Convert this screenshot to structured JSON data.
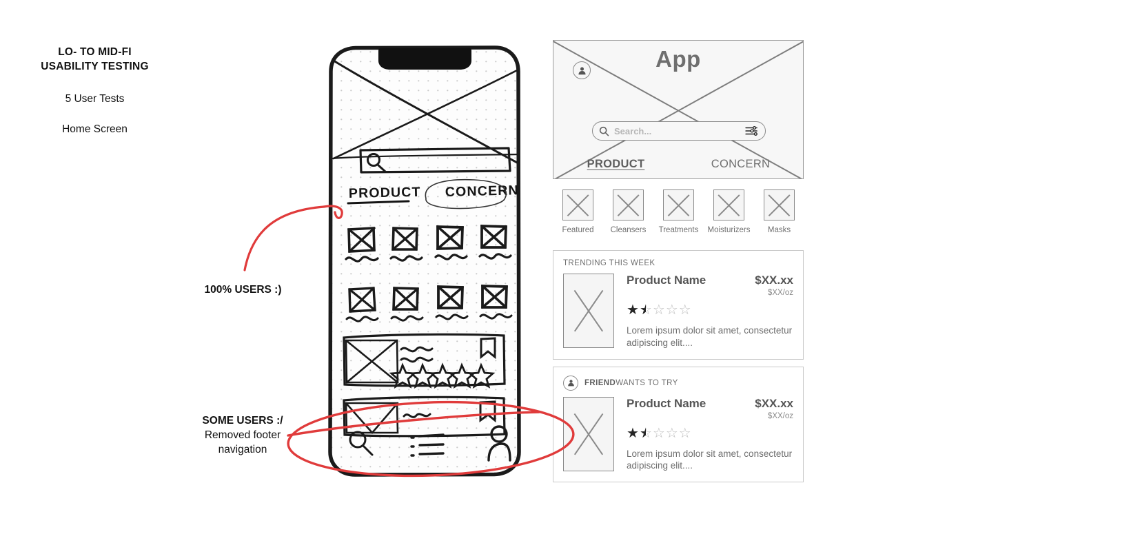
{
  "annotations": {
    "title_line1": "LO- TO MID-FI",
    "title_line2": "USABILITY TESTING",
    "user_tests": "5 User Tests",
    "screen_name": "Home Screen",
    "note_top": "100% USERS :)",
    "note_bottom_strong": "SOME USERS :/",
    "note_bottom_line1": "Removed footer",
    "note_bottom_line2": "navigation",
    "markup_color": "#e03b3b"
  },
  "sketch": {
    "name": "hand-drawn-lofi-phone-wireframe",
    "tabs": [
      "PRODUCT",
      "CONCERN"
    ],
    "search_placeholder_glyph": "magnifier",
    "grid_rows": 2,
    "grid_columns": 4,
    "card_count": 2,
    "footer_icons": [
      "search-icon",
      "list-icon",
      "person-icon"
    ]
  },
  "mockup": {
    "app_title": "App",
    "search": {
      "placeholder": "Search...",
      "search_icon": "search-icon",
      "filter_icon": "filter-sliders-icon"
    },
    "avatar_icon": "person-icon",
    "tabs": [
      {
        "label": "PRODUCT",
        "active": true
      },
      {
        "label": "CONCERN",
        "active": false
      }
    ],
    "categories": [
      {
        "label": "Featured"
      },
      {
        "label": "Cleansers"
      },
      {
        "label": "Treatments"
      },
      {
        "label": "Moisturizers"
      },
      {
        "label": "Masks"
      }
    ],
    "cards": [
      {
        "eyebrow_strong": "",
        "eyebrow_rest": "TRENDING THIS WEEK",
        "has_avatar": false,
        "name": "Product Name",
        "price": "$XX.xx",
        "unit_price": "$XX/oz",
        "rating": 1.5,
        "rating_max": 5,
        "description": "Lorem ipsum dolor sit amet, consectetur adipiscing elit...."
      },
      {
        "eyebrow_strong": "FRIEND",
        "eyebrow_rest": " WANTS TO TRY",
        "has_avatar": true,
        "name": "Product Name",
        "price": "$XX.xx",
        "unit_price": "$XX/oz",
        "rating": 1.5,
        "rating_max": 5,
        "description": "Lorem ipsum dolor sit amet, consectetur adipiscing elit...."
      }
    ]
  }
}
